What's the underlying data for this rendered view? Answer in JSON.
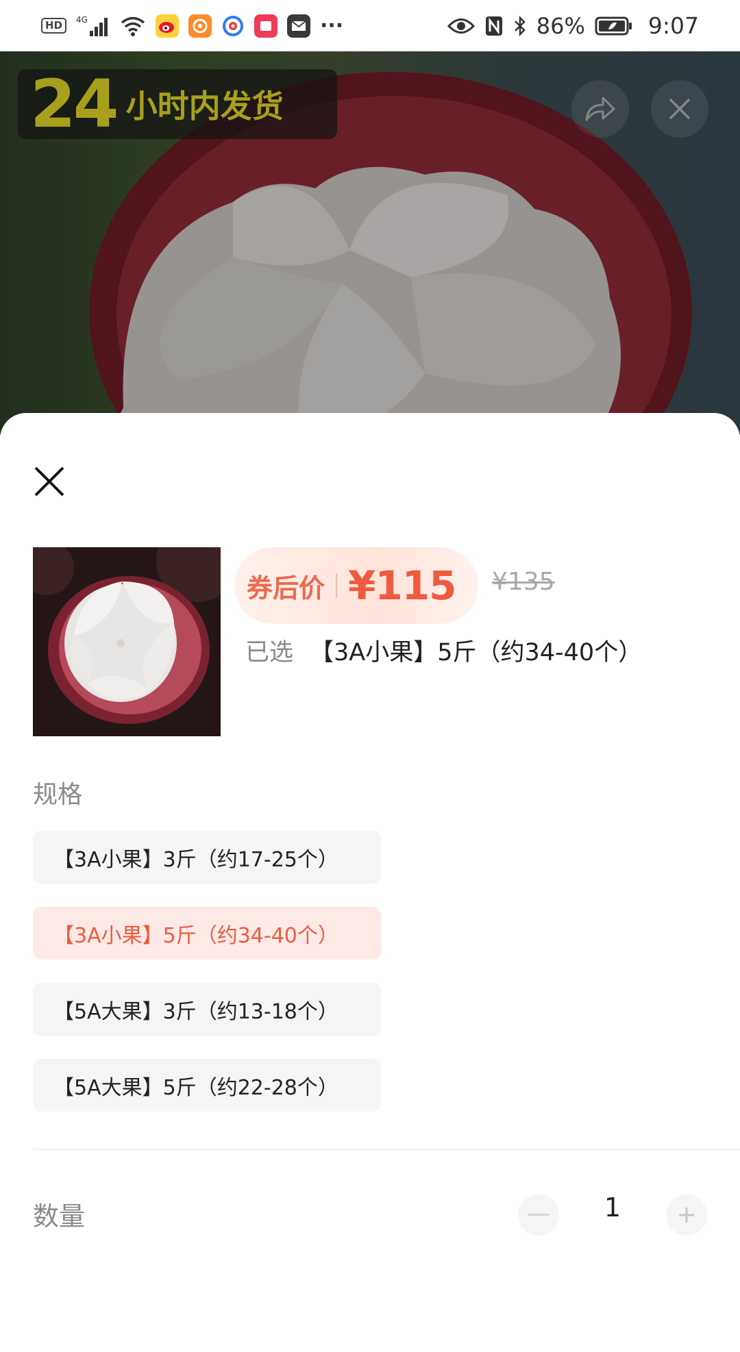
{
  "status_bar": {
    "hd_label": "HD",
    "network_label": "4G",
    "more_label": "···",
    "battery_percent": "86%",
    "time": "9:07",
    "icons": [
      "hd-icon",
      "signal-4g-icon",
      "wifi-icon",
      "weibo-app-icon",
      "orange-app-icon",
      "camera-app-icon",
      "red-app-icon",
      "mail-app-icon",
      "more-icon",
      "eye-icon",
      "nfc-icon",
      "bluetooth-icon",
      "battery-icon"
    ]
  },
  "hero": {
    "badge_number": "24",
    "badge_text": "小时内发货",
    "share_icon": "share-icon",
    "close_icon": "close-icon"
  },
  "sheet": {
    "close_icon": "close-icon",
    "price": {
      "label": "券后价",
      "value": "¥115",
      "original": "¥135"
    },
    "selected": {
      "label": "已选",
      "value": "【3A小果】5斤（约34-40个）"
    },
    "spec": {
      "title": "规格",
      "options": [
        {
          "label": "【3A小果】3斤（约17-25个）",
          "selected": false
        },
        {
          "label": "【3A小果】5斤（约34-40个）",
          "selected": true
        },
        {
          "label": "【5A大果】3斤（约13-18个）",
          "selected": false
        },
        {
          "label": "【5A大果】5斤（约22-28个）",
          "selected": false
        }
      ]
    },
    "quantity": {
      "label": "数量",
      "value": "1",
      "minus_icon": "minus-icon",
      "plus_icon": "plus-icon"
    }
  },
  "colors": {
    "accent": "#ee5b3f",
    "badge_yellow": "#a8a01c",
    "selected_bg": "#fdeae6"
  }
}
